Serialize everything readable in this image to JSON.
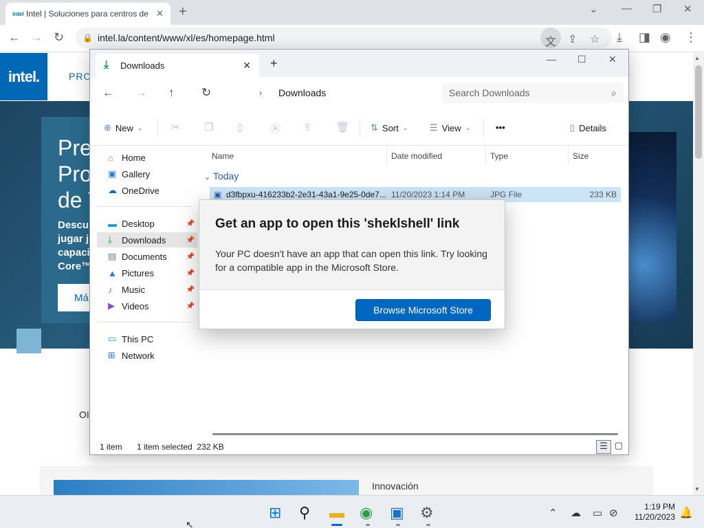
{
  "browser": {
    "tab_favicon": "intel",
    "tab_title": "Intel | Soluciones para centros de",
    "tab_close": "✕",
    "new_tab": "+",
    "url": "intel.la/content/www/xl/es/homepage.html"
  },
  "page": {
    "logo": "intel.",
    "nav_first": "PRO",
    "hero_heading_lines": [
      "Pre",
      "Pro",
      "de T"
    ],
    "hero_para_lines": [
      "Descu",
      "jugar j",
      "capaci",
      "Core™"
    ],
    "hero_button": "Má",
    "section_partial": "OI",
    "innovation": "Innovación"
  },
  "explorer": {
    "tab_label": "Downloads",
    "tab_close": "✕",
    "new_tab": "+",
    "path_current": "Downloads",
    "search_placeholder": "Search Downloads",
    "command_bar": {
      "new_label": "New",
      "sort_label": "Sort",
      "view_label": "View",
      "more_label": "•••",
      "details_label": "Details"
    },
    "sidebar": {
      "items_top": [
        {
          "label": "Home",
          "icon": "home-icon"
        },
        {
          "label": "Gallery",
          "icon": "gallery-icon"
        },
        {
          "label": "OneDrive",
          "icon": "cloud-icon"
        }
      ],
      "items_pinned": [
        {
          "label": "Desktop",
          "icon": "desktop-icon"
        },
        {
          "label": "Downloads",
          "icon": "download-icon"
        },
        {
          "label": "Documents",
          "icon": "documents-icon"
        },
        {
          "label": "Pictures",
          "icon": "pictures-icon"
        },
        {
          "label": "Music",
          "icon": "music-icon"
        },
        {
          "label": "Videos",
          "icon": "videos-icon"
        }
      ],
      "items_bottom": [
        {
          "label": "This PC",
          "icon": "pc-icon"
        },
        {
          "label": "Network",
          "icon": "network-icon"
        }
      ]
    },
    "columns": [
      "Name",
      "Date modified",
      "Type",
      "Size"
    ],
    "group": "Today",
    "files": [
      {
        "name": "d3fbpxu-416233b2-2e31-43a1-9e25-0de7...",
        "date": "11/20/2023 1:14 PM",
        "type": "JPG File",
        "size": "233 KB"
      }
    ],
    "status": {
      "count": "1 item",
      "selected": "1 item selected  232 KB"
    }
  },
  "dialog": {
    "title": "Get an app to open this 'sheklshell' link",
    "message": "Your PC doesn't have an app that can open this link. Try looking for a compatible app in the Microsoft Store.",
    "button": "Browse Microsoft Store"
  },
  "taskbar": {
    "time": "1:19 PM",
    "date": "11/20/2023"
  },
  "colors": {
    "intel_blue": "#0068b5",
    "accent": "#0067c0",
    "selection": "#cce4f7"
  }
}
